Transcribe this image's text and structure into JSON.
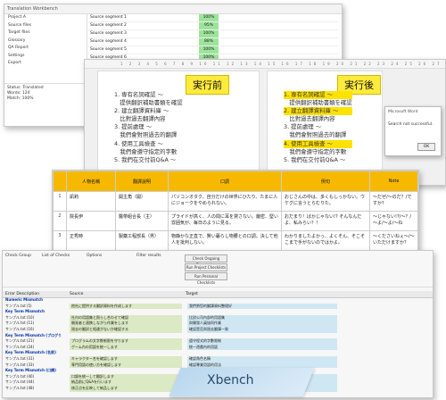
{
  "tool": {
    "title": "Translation Workbench",
    "tree": [
      "Project A",
      "Source files",
      "Target files",
      "Glossary",
      "QA Report",
      "Settings",
      "Export"
    ],
    "segments": [
      {
        "src": "Source segment 1",
        "pct": "100%"
      },
      {
        "src": "Source segment 2",
        "pct": "95%"
      },
      {
        "src": "Source segment 3",
        "pct": "100%"
      },
      {
        "src": "Source segment 4",
        "pct": "88%"
      },
      {
        "src": "Source segment 5",
        "pct": "100%"
      },
      {
        "src": "Source segment 6",
        "pct": "100%"
      }
    ],
    "props": [
      "Status: Translated",
      "Words: 124",
      "Match: 100%"
    ]
  },
  "doc": {
    "before_label": "実行前",
    "after_label": "実行後",
    "lines": [
      "1. 専有名詞確認 ～",
      "　提供翻訳補助書類を確認",
      "2. 建立翻譯資料庫 ～",
      "　比對過去翻譯內容",
      "3. 提前處理 ～",
      "　我們會對照過去的翻譯",
      "4. 使用工具檢查 ～",
      "　我們會遵守指定的字數",
      "5. 我們在交付前Q&A ～"
    ],
    "dialog": {
      "title": "Microsoft Word",
      "message": "Search not successful.",
      "ok": "OK"
    }
  },
  "glossary": {
    "headers": [
      "",
      "人物名稱",
      "翻譯說明",
      "口調",
      "例句",
      "Note"
    ],
    "rows": [
      [
        "1",
        "凱莉",
        "開主角（開）",
        "パソコンオタク。自分だけの世界にひたり、たまに人にジョークをやめられない。",
        "おじさんの中は、多くもしっかない。ウケグに言うとらむりた。",
        "～だぜ/～のだ？/ですか？"
      ],
      [
        "2",
        "院長伊",
        "醫帶組合長（主）",
        "プライドが高く、人の間に耳を貸さない。厳密、堅い雰囲気が、毎日のように見る。",
        "おだまり！ばかじゃない!? そんなんだよ、私みらい？！",
        "～じゃない!?/～？/～よ/～よ/～ね"
      ],
      [
        "3",
        "正秀時",
        "製藥工程部長（男）",
        "物静かな正直で、賢い暮らし物腰との口調。決して他人を批判しない。",
        "わかりましたよかっ、よくそん、そこそこまで手がないのではかよ。",
        "～くださいねぇ～/～いただけますか？"
      ]
    ]
  },
  "xbench": {
    "label": "Xbench",
    "check_group": "Check Group",
    "list_of_checks": "List of Checks",
    "options": "Options",
    "filter": "Filter results",
    "buttons": [
      "Check Ongoing Translation",
      "Run Project Checklists",
      "Run Personal Checklists"
    ],
    "headers": [
      "Error Description",
      "Source",
      "Target"
    ],
    "rows": [
      {
        "k": true,
        "c1": "Numeric Mismatch",
        "c3": "",
        "c5": ""
      },
      {
        "k": false,
        "c1": "サンプル.txt (5)",
        "c3": "他社に提供する翻訳資料を作成します",
        "c5": "我們將您的翻譯資料整理好"
      },
      {
        "k": true,
        "c1": "Key Term Mismatch",
        "c3": "",
        "c5": ""
      },
      {
        "k": false,
        "c1": "サンプル.txt (10)",
        "c3": "社内の用語集と照らし合わせて確認",
        "c5": "比對公司內部的用語集"
      },
      {
        "k": false,
        "c1": "サンプル.txt (11)",
        "c3": "開発者と連携しながら作業をします",
        "c5": "與開發人員協同作業"
      },
      {
        "k": false,
        "c1": "サンプル.txt (16)",
        "c3": "過去の翻訳と相違がないか確認する",
        "c5": "確認是否與過去翻譯一致"
      },
      {
        "k": true,
        "c1": "Key Term Mismatch (プログラム)",
        "c3": "",
        "c5": ""
      },
      {
        "k": false,
        "c1": "サンプル.txt (21)",
        "c3": "プログラムの文字数制限を守ります",
        "c5": "遵守程式的字數限制"
      },
      {
        "k": false,
        "c1": "サンプル.txt (24)",
        "c3": "ゲーム内の用語を統一します",
        "c5": "統一遊戲內的用語"
      },
      {
        "k": true,
        "c1": "Key Term Mismatch (名前)",
        "c3": "",
        "c5": ""
      },
      {
        "k": false,
        "c1": "サンプル.txt (31)",
        "c3": "キャラクター名を確認します",
        "c5": "確認角色名稱"
      },
      {
        "k": false,
        "c1": "サンプル.txt (33)",
        "c3": "専門用語の使い方を確認します",
        "c5": "確認專業用語的用法"
      },
      {
        "k": true,
        "c1": "Key Term Mismatch (口調)",
        "c3": "",
        "c5": ""
      },
      {
        "k": false,
        "c1": "サンプル.txt (40)",
        "c3": "口調を統一して翻訳します",
        "c5": "統一語氣進行翻譯"
      },
      {
        "k": false,
        "c1": "サンプル.txt (44)",
        "c3": "納品前にQ&Aを行います",
        "c5": "交付前進行Q&A"
      },
      {
        "k": false,
        "c1": "サンプル.txt (48)",
        "c3": "修正点を反映して納品します",
        "c5": "反映修正後交付"
      }
    ]
  }
}
